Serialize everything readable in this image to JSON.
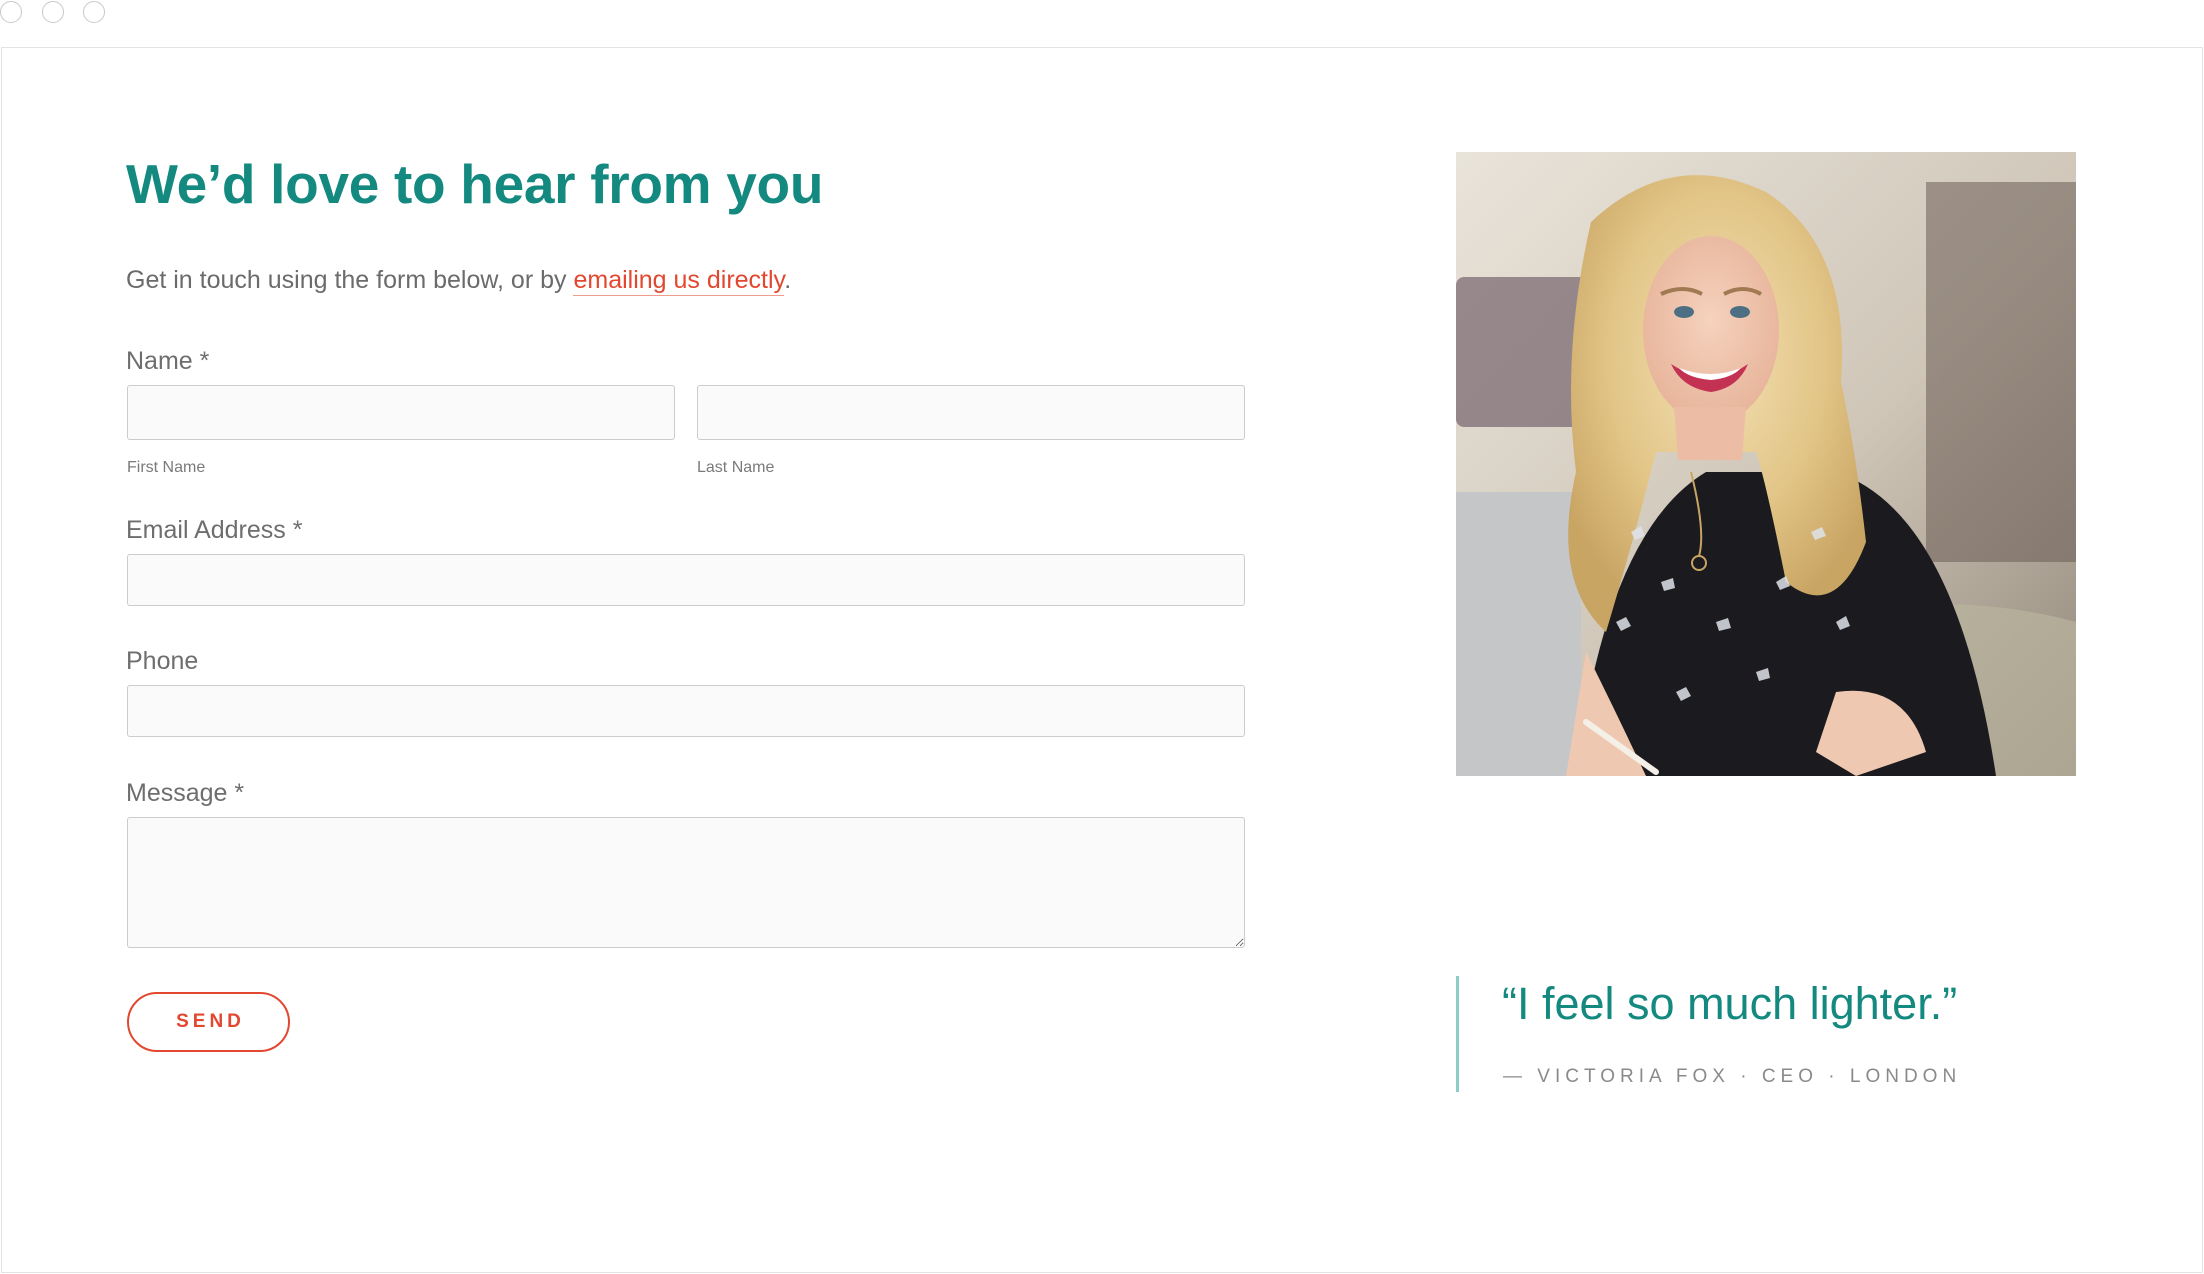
{
  "form": {
    "heading": "We’d love to hear from you",
    "intro_prefix": "Get in touch using the form below, or by ",
    "intro_link": "emailing us directly",
    "intro_suffix": ".",
    "name_label": "Name *",
    "first_name_sublabel": "First Name",
    "last_name_sublabel": "Last Name",
    "first_name_value": "",
    "last_name_value": "",
    "email_label": "Email Address *",
    "email_value": "",
    "phone_label": "Phone",
    "phone_value": "",
    "message_label": "Message *",
    "message_value": "",
    "send_label": "SEND"
  },
  "testimonial": {
    "quote": "“I feel so much lighter.”",
    "attribution": "— VICTORIA FOX · CEO · LONDON"
  },
  "colors": {
    "accent_teal": "#14897f",
    "accent_red": "#e2472f"
  }
}
